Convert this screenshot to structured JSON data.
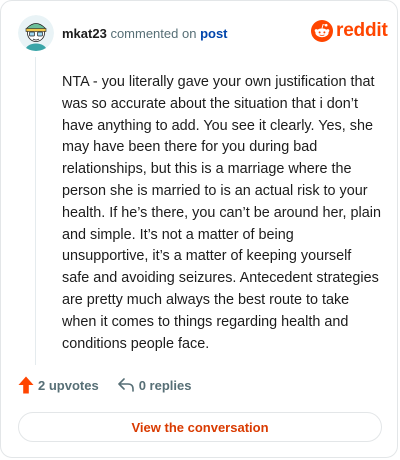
{
  "header": {
    "username": "mkat23",
    "action_text": "commented on",
    "post_link": "post",
    "brand": "reddit"
  },
  "comment": {
    "body": "NTA - you literally gave your own justification that was so accurate about the situation that i don’t have anything to add. You see it clearly. Yes, she may have been there for you during bad relationships, but this is a marriage where the person she is married to is an actual risk to your health. If he’s there, you can’t be around her, plain and simple. It’s not a matter of being unsupportive, it’s a matter of keeping yourself safe and avoiding seizures. Antecedent strategies are pretty much always the best route to take when it comes to things regarding health and conditions people face."
  },
  "footer": {
    "upvotes_label": "2 upvotes",
    "replies_label": "0 replies",
    "view_button": "View the conversation"
  },
  "colors": {
    "brand": "#ff4500",
    "link": "#0045ac",
    "button_text": "#d93a00",
    "muted": "#576f76"
  }
}
